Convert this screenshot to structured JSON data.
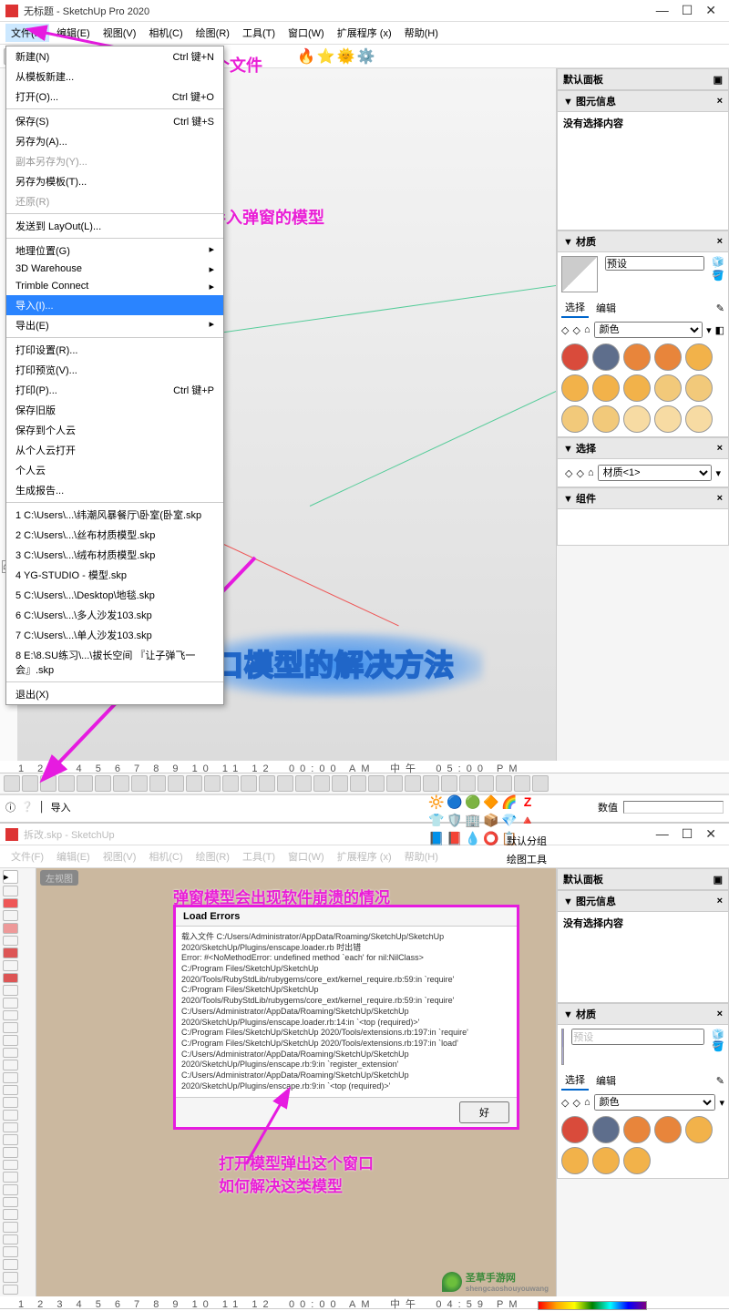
{
  "app": {
    "title1": "无标题 - SketchUp Pro 2020",
    "title2": "拆改.skp - SketchUp"
  },
  "menubar": [
    "文件(F)",
    "编辑(E)",
    "视图(V)",
    "相机(C)",
    "绘图(R)",
    "工具(T)",
    "窗口(W)",
    "扩展程序 (x)",
    "帮助(H)"
  ],
  "filemenu": {
    "items": [
      {
        "label": "新建(N)",
        "shortcut": "Ctrl 键+N"
      },
      {
        "label": "从模板新建..."
      },
      {
        "label": "打开(O)...",
        "shortcut": "Ctrl 键+O"
      },
      {
        "sep": true
      },
      {
        "label": "保存(S)",
        "shortcut": "Ctrl 键+S"
      },
      {
        "label": "另存为(A)..."
      },
      {
        "label": "副本另存为(Y)...",
        "dis": true
      },
      {
        "label": "另存为模板(T)..."
      },
      {
        "label": "还原(R)",
        "dis": true
      },
      {
        "sep": true
      },
      {
        "label": "发送到 LayOut(L)..."
      },
      {
        "sep": true
      },
      {
        "label": "地理位置(G)",
        "arrow": "▸"
      },
      {
        "label": "3D Warehouse",
        "arrow": "▸"
      },
      {
        "label": "Trimble Connect",
        "arrow": "▸"
      },
      {
        "label": "导入(I)...",
        "hl": true
      },
      {
        "label": "导出(E)",
        "arrow": "▸"
      },
      {
        "sep": true
      },
      {
        "label": "打印设置(R)..."
      },
      {
        "label": "打印预览(V)..."
      },
      {
        "label": "打印(P)...",
        "shortcut": "Ctrl 键+P"
      },
      {
        "label": "保存旧版"
      },
      {
        "label": "保存到个人云"
      },
      {
        "label": "从个人云打开"
      },
      {
        "label": "个人云"
      },
      {
        "label": "生成报告..."
      },
      {
        "sep": true
      },
      {
        "label": "1 C:\\Users\\...\\纬潮风暴餐厅\\卧室(卧室.skp"
      },
      {
        "label": "2 C:\\Users\\...\\丝布材质模型.skp"
      },
      {
        "label": "3 C:\\Users\\...\\绒布材质模型.skp"
      },
      {
        "label": "4 YG-STUDIO - 模型.skp"
      },
      {
        "label": "5 C:\\Users\\...\\Desktop\\地毯.skp"
      },
      {
        "label": "6 C:\\Users\\...\\多人沙发103.skp"
      },
      {
        "label": "7 C:\\Users\\...\\单人沙发103.skp"
      },
      {
        "label": "8 E:\\8.SU练习\\...\\拔长空间 『让子弹飞一会』.skp"
      },
      {
        "sep": true
      },
      {
        "label": "退出(X)"
      }
    ]
  },
  "annotations": {
    "a1": "新建一个文件",
    "a2": "导入弹窗的模型",
    "big": "弹出此类窗口模型的解决方法",
    "a3": "弹窗模型会出现软件崩溃的情况",
    "a4_1": "打开模型弹出这个窗口",
    "a4_2": "如何解决这类模型"
  },
  "panels": {
    "defaultPanel": "默认面板",
    "entityInfo": "图元信息",
    "noSelection": "没有选择内容",
    "materials": "材质",
    "select": "选择",
    "edit": "编辑",
    "color": "颜色",
    "mat": "材质<1>",
    "default_mat": "预设",
    "components": "组件",
    "value": "数值",
    "swatches1": [
      "#d94b3b",
      "#5e6e8c",
      "#e8853b",
      "#e8853b",
      "#f2b24a",
      "#f2b24a",
      "#f2b24a",
      "#f2b24a",
      "#f2c97a",
      "#f2c97a",
      "#f2c97a",
      "#f2c97a",
      "#f7dba3",
      "#f7dba3",
      "#f7dba3"
    ],
    "swatches2": [
      "#d94b3b",
      "#5e6e8c",
      "#e8853b",
      "#e8853b",
      "#f2b24a",
      "#f2b24a",
      "#f2b24a",
      "#f2b24a"
    ]
  },
  "error": {
    "title": "Load Errors",
    "lines": [
      "载入文件 C:/Users/Administrator/AppData/Roaming/SketchUp/SketchUp 2020/SketchUp/Plugins/enscape.loader.rb 时出错",
      "Error: #<NoMethodError: undefined method `each' for nil:NilClass>",
      "C:/Program Files/SketchUp/SketchUp 2020/Tools/RubyStdLib/rubygems/core_ext/kernel_require.rb:59:in `require'",
      "C:/Program Files/SketchUp/SketchUp 2020/Tools/RubyStdLib/rubygems/core_ext/kernel_require.rb:59:in `require'",
      "C:/Users/Administrator/AppData/Roaming/SketchUp/SketchUp 2020/SketchUp/Plugins/enscape.loader.rb:14:in `<top (required)>'",
      "C:/Program Files/SketchUp/SketchUp 2020/Tools/extensions.rb:197:in `require'",
      "C:/Program Files/SketchUp/SketchUp 2020/Tools/extensions.rb:197:in `load'",
      "C:/Users/Administrator/AppData/Roaming/SketchUp/SketchUp 2020/SketchUp/Plugins/enscape.rb:9:in `register_extension'",
      "C:/Users/Administrator/AppData/Roaming/SketchUp/SketchUp 2020/SketchUp/Plugins/enscape.rb:9:in `<top (required)>'"
    ],
    "ok": "好"
  },
  "status": {
    "hint": "导入",
    "ruler": "1 2 3 4 5 6 7 8 9 10 11 12",
    "t1": "00:00 AM",
    "t2": "中午",
    "t3": "05:00 PM",
    "t4": "04:59 PM"
  },
  "side": {
    "defaultGroup": "默认分组",
    "drawTools": "绘图工具"
  },
  "watermark": {
    "name": "圣草手游网",
    "url": "shengcaoshouyouwang"
  }
}
